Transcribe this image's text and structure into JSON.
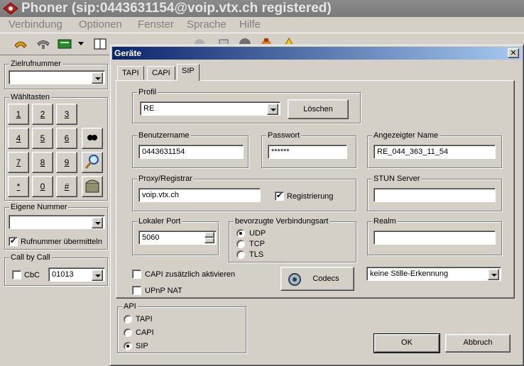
{
  "window": {
    "title": "Phoner (sip:0443631154@voip.vtx.ch registered)"
  },
  "menu": [
    "Verbindung",
    "Optionen",
    "Fenster",
    "Sprache",
    "Hilfe"
  ],
  "sidebar": {
    "zielrufnummer_label": "Zielrufnummer",
    "zielrufnummer_value": "",
    "waehltasten_label": "Wähltasten",
    "keys": [
      "1",
      "2",
      "3",
      "4",
      "5",
      "6",
      "7",
      "8",
      "9",
      "*",
      "0",
      "#"
    ],
    "eigene_nummer_label": "Eigene Nummer",
    "eigene_nummer_value": "",
    "rufnummer_label": "Rufnummer übermitteln",
    "rufnummer_checked": true,
    "callbycall_label": "Call by Call",
    "cbc_label": "CbC",
    "cbc_checked": false,
    "cbc_value": "01013"
  },
  "dialog": {
    "title": "Geräte",
    "close_glyph": "✕",
    "tabs": [
      "TAPI",
      "CAPI",
      "SIP"
    ],
    "active_tab": "SIP",
    "profil_label": "Profil",
    "profil_value": "RE",
    "loeschen_button": "Löschen",
    "benutzername_label": "Benutzername",
    "benutzername_value": "0443631154",
    "passwort_label": "Passwort",
    "passwort_value": "******",
    "anzeigename_label": "Angezeigter Name",
    "anzeigename_value": "RE_044_363_11_54",
    "proxy_label": "Proxy/Registrar",
    "proxy_value": "voip.vtx.ch",
    "registrierung_label": "Registrierung",
    "registrierung_checked": true,
    "stun_label": "STUN Server",
    "stun_value": "",
    "lokaler_port_label": "Lokaler Port",
    "lokaler_port_value": "5060",
    "verbindungsart_label": "bevorzugte Verbindungsart",
    "verbindungsart_options": [
      "UDP",
      "TCP",
      "TLS"
    ],
    "verbindungsart_selected": "UDP",
    "realm_label": "Realm",
    "realm_value": "",
    "capi_zusaetzlich_label": "CAPI zusätzlich aktivieren",
    "upnp_label": "UPnP NAT",
    "codecs_button": "Codecs",
    "stille_value": "keine Stille-Erkennung",
    "api_label": "API",
    "api_options": [
      "TAPI",
      "CAPI",
      "SIP"
    ],
    "api_selected": "SIP",
    "ok_button": "OK",
    "abbruch_button": "Abbruch"
  }
}
